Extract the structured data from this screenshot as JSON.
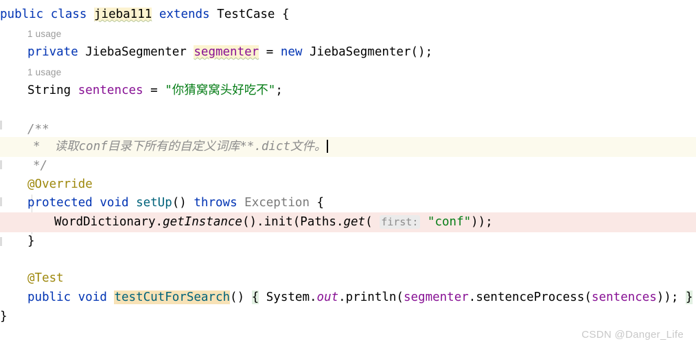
{
  "editor": {
    "language": "java",
    "watermark": "CSDN @Danger_Life",
    "colors": {
      "background": "#ffffff",
      "keyword": "#0033b3",
      "field": "#871094",
      "string": "#067d17",
      "annotation": "#9e880d",
      "method_declaration": "#00627a",
      "comment": "#8c8c8c",
      "inlay_hint": "#9a9a9a",
      "comment_line_background": "#fcfaed",
      "error_line_background": "#fae8e5",
      "identifier_highlight": "#fcf3d0",
      "selected_identifier_highlight": "#f7e2b6",
      "matched_brace_highlight": "#e1f0e1",
      "param_hint_background": "#ebebeb"
    }
  },
  "inlay_hints": [
    {
      "text": "1 usage"
    },
    {
      "text": "1 usage"
    }
  ],
  "code": {
    "l1_public": "public",
    "l1_class": "class",
    "l1_name": "jieba111",
    "l1_extends": "extends",
    "l1_super": "TestCase",
    "l1_brace": "{",
    "l3_private": "private",
    "l3_type": "JiebaSegmenter",
    "l3_field": "segmenter",
    "l3_eq": "=",
    "l3_new": "new",
    "l3_ctor": "JiebaSegmenter();",
    "l5_type": "String",
    "l5_field": "sentences",
    "l5_eq": "=",
    "l5_string": "\"你猜窝窝头好吃不\"",
    "l5_semi": ";",
    "l7_doc_open": "/**",
    "l8_doc_star": "*",
    "l8_doc_text": "读取conf目录下所有的自定义词库**.dict文件。",
    "l9_doc_close": "*/",
    "l10_annotation": "@Override",
    "l11_protected": "protected",
    "l11_void": "void",
    "l11_method": "setUp",
    "l11_parens": "()",
    "l11_throws": "throws",
    "l11_exception": "Exception",
    "l11_brace": "{",
    "l12_class": "WordDictionary",
    "l12_dot1": ".",
    "l12_getinstance": "getInstance",
    "l12_parens1": "().",
    "l12_init": "init(",
    "l12_paths": "Paths.",
    "l12_get": "get",
    "l12_open": "(",
    "l12_hint": "first:",
    "l12_arg": "\"conf\"",
    "l12_close": "));",
    "l13_brace": "}",
    "l15_annotation": "@Test",
    "l16_public": "public",
    "l16_void": "void",
    "l16_method": "testCutForSearch",
    "l16_parens": "()",
    "l16_open_brace": "{",
    "l16_system": "System.",
    "l16_out": "out",
    "l16_println": ".println(",
    "l16_segmenter": "segmenter",
    "l16_sentence_process": ".sentenceProcess(",
    "l16_sentences": "sentences",
    "l16_tail": "));",
    "l16_close_brace": "}",
    "l17_brace": "}"
  }
}
